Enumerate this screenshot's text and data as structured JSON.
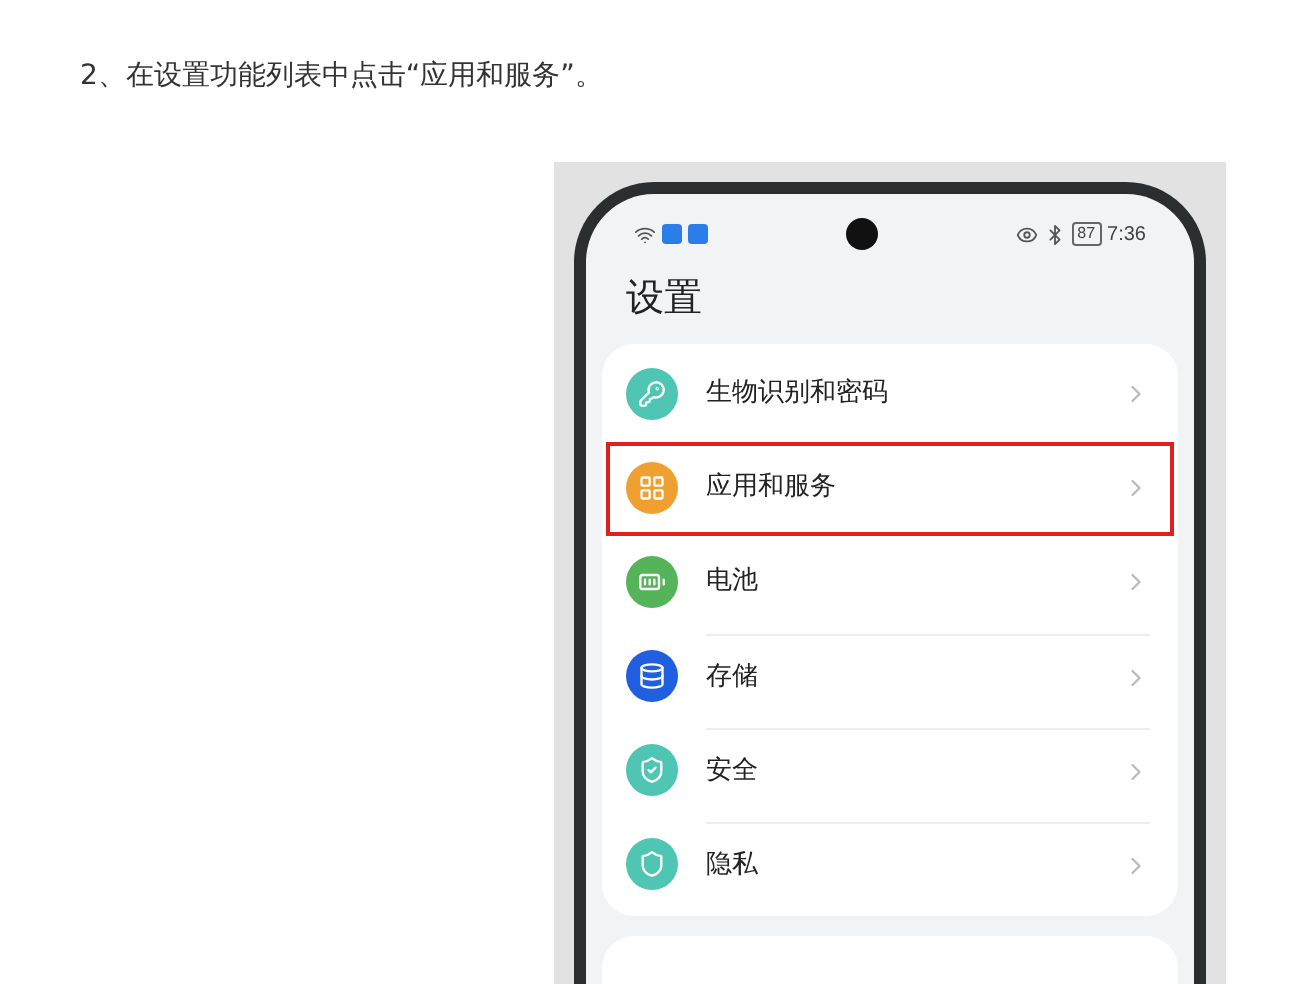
{
  "instruction": "2、在设置功能列表中点击“应用和服务”。",
  "phone": {
    "status_bar": {
      "battery": "87",
      "time": "7:36"
    },
    "title": "设置",
    "items": [
      {
        "label": "生物识别和密码",
        "kind": "key",
        "color": "#4fc5b3",
        "selected": false
      },
      {
        "label": "应用和服务",
        "kind": "apps",
        "color": "#f0a030",
        "selected": true
      },
      {
        "label": "电池",
        "kind": "battery",
        "color": "#55b35a",
        "selected": false
      },
      {
        "label": "存储",
        "kind": "storage",
        "color": "#1f5fe0",
        "selected": false
      },
      {
        "label": "安全",
        "kind": "security",
        "color": "#4fc5b3",
        "selected": false
      },
      {
        "label": "隐私",
        "kind": "privacy",
        "color": "#4fc5b3",
        "selected": false
      }
    ]
  }
}
